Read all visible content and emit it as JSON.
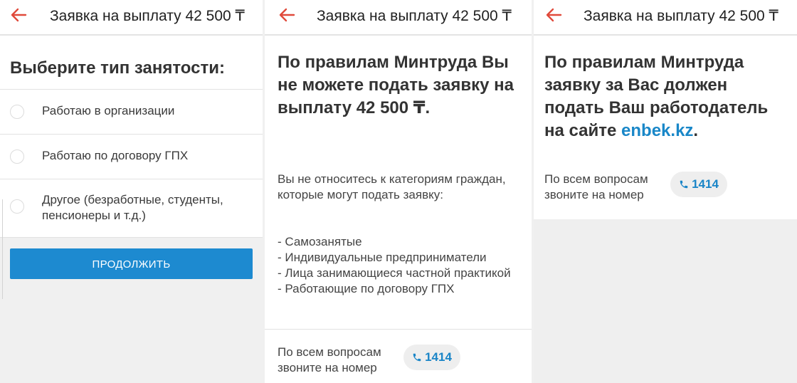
{
  "app_title": "Заявка на выплату 42 500 ₸",
  "colors": {
    "accent": "#1d8ad0",
    "link": "#1987c8",
    "back_arrow": "#e04a3b"
  },
  "panel1": {
    "heading": "Выберите тип занятости:",
    "options": [
      "Работаю в организации",
      "Работаю по договору ГПХ",
      "Другое (безработные, студенты, пенсионеры и т.д.)"
    ],
    "continue_label": "ПРОДОЛЖИТЬ"
  },
  "panel2": {
    "heading": "По правилам Минтруда Вы не можете подать заявку на выплату 42 500 ₸.",
    "paragraph": "Вы не относитесь к категориям граждан, которые могут подать заявку:",
    "list": [
      "- Самозанятые",
      "- Индивидуальные предприниматели",
      "- Лица занимающиеся частной практикой",
      "- Работающие по договору ГПХ"
    ],
    "contact_text": "По всем вопросам звоните на номер",
    "phone": "1414"
  },
  "panel3": {
    "heading_prefix": "По правилам Минтруда заявку за Вас должен подать Ваш работодатель на сайте ",
    "heading_link": "enbek.kz",
    "heading_suffix": ".",
    "contact_text": "По всем вопросам звоните на номер",
    "phone": "1414"
  },
  "icons": {
    "back": "back-arrow-icon",
    "phone": "phone-icon"
  }
}
